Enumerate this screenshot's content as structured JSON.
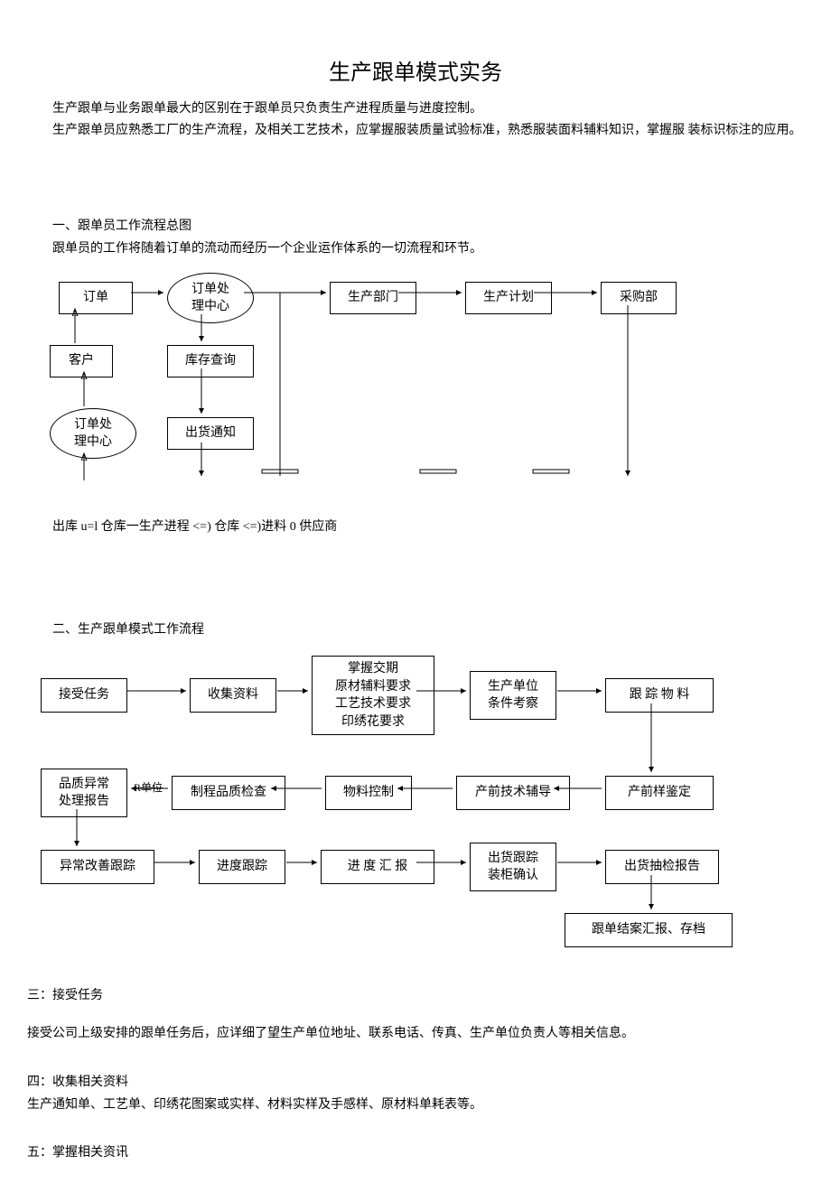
{
  "title": "生产跟单模式实务",
  "intro1": "生产跟单与业务跟单最大的区别在于跟单员只负责生产进程质量与进度控制。",
  "intro2": "生产跟单员应熟悉工厂的生产流程，及相关工艺技术，应掌握服装质量试验标准，熟悉服装面料辅料知识，掌握服 装标识标注的应用。",
  "section1_title": "一、跟单员工作流程总图",
  "section1_desc": "跟单员的工作将随着订单的流动而经历一个企业运作体系的一切流程和环节。",
  "flow1": {
    "order": "订单",
    "order_center": "订单处\n理中心",
    "prod_dept": "生产部门",
    "prod_plan": "生产计划",
    "purchase_dept": "采购部",
    "customer": "客户",
    "stock_query": "库存查询",
    "order_center2": "订单处\n理中心",
    "ship_notice": "出货通知"
  },
  "flow1_caption": "出库 u=l 仓库一生产进程 <=)  仓库 <=)进料 0 供应商",
  "section2_title": "二、生产跟单模式工作流程",
  "flow2": {
    "accept_task": "接受任务",
    "collect_data": "收集资料",
    "grasp": "掌握交期\n原材辅料要求\n工艺技术要求\n印绣花要求",
    "inspect_unit": "生产单位\n条件考察",
    "track_mat": "跟 踪 物 料",
    "quality_report": "品质异常\n处理报告",
    "r_unit": "R单位",
    "process_check": "制程品质检查",
    "mat_control": "物料控制",
    "preprod_guide": "产前技术辅导",
    "preprod_sample": "产前样鉴定",
    "improve_track": "异常改善跟踪",
    "progress_track": "进度跟踪",
    "progress_report": "进 度 汇 报",
    "ship_track": "出货跟踪\n装柜确认",
    "ship_check": "出货抽检报告",
    "close_report": "跟单结案汇报、存档"
  },
  "section3_title": "三：接受任务",
  "section3_body": "接受公司上级安排的跟单任务后，应详细了望生产单位地址、联系电话、传真、生产单位负责人等相关信息。",
  "section4_title": "四：收集相关资料",
  "section4_body": "生产通知单、工艺单、印绣花图案或实样、材料实样及手感样、原材料单耗表等。",
  "section5_title": "五：掌握相关资讯"
}
